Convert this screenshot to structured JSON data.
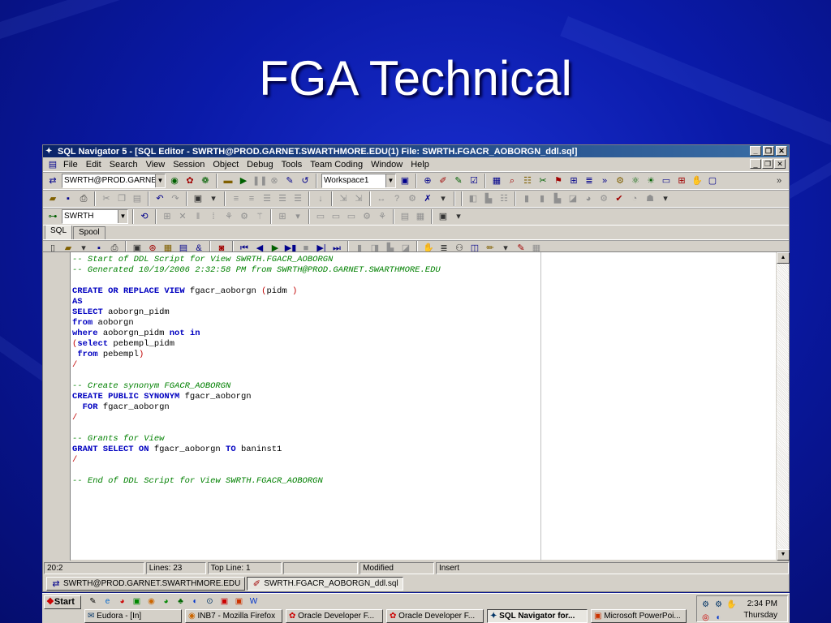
{
  "slide": {
    "title": "FGA Technical"
  },
  "window": {
    "title": "SQL Navigator 5 - [SQL Editor - SWRTH@PROD.GARNET.SWARTHMORE.EDU(1) File: SWRTH.FGACR_AOBORGN_ddl.sql]",
    "menu": [
      "File",
      "Edit",
      "Search",
      "View",
      "Session",
      "Object",
      "Debug",
      "Tools",
      "Team Coding",
      "Window",
      "Help"
    ],
    "connection_combo": "SWRTH@PROD.GARNET",
    "workspace_combo": "Workspace1",
    "schema_combo": "SWRTH",
    "tabs": [
      "SQL",
      "Spool"
    ]
  },
  "editor": {
    "lines": [
      [
        {
          "t": "cm",
          "v": "-- Start of DDL Script for View SWRTH.FGACR_AOBORGN"
        }
      ],
      [
        {
          "t": "cm",
          "v": "-- Generated 10/19/2006 2:32:58 PM from SWRTH@PROD.GARNET.SWARTHMORE.EDU"
        }
      ],
      [],
      [
        {
          "t": "kw",
          "v": "CREATE OR REPLACE VIEW"
        },
        {
          "t": "tx",
          "v": " fgacr_aoborgn "
        },
        {
          "t": "pn",
          "v": "("
        },
        {
          "t": "tx",
          "v": "pidm "
        },
        {
          "t": "pn",
          "v": ")"
        }
      ],
      [
        {
          "t": "kw",
          "v": "AS"
        }
      ],
      [
        {
          "t": "kw",
          "v": "SELECT"
        },
        {
          "t": "tx",
          "v": " aoborgn_pidm"
        }
      ],
      [
        {
          "t": "kw",
          "v": "from"
        },
        {
          "t": "tx",
          "v": " aoborgn"
        }
      ],
      [
        {
          "t": "kw",
          "v": "where"
        },
        {
          "t": "tx",
          "v": " aoborgn_pidm "
        },
        {
          "t": "kw",
          "v": "not in"
        }
      ],
      [
        {
          "t": "pn",
          "v": "("
        },
        {
          "t": "kw",
          "v": "select"
        },
        {
          "t": "tx",
          "v": " pebempl_pidm"
        }
      ],
      [
        {
          "t": "tx",
          "v": " "
        },
        {
          "t": "kw",
          "v": "from"
        },
        {
          "t": "tx",
          "v": " pebempl"
        },
        {
          "t": "pn",
          "v": ")"
        }
      ],
      [
        {
          "t": "pn",
          "v": "/"
        }
      ],
      [],
      [
        {
          "t": "cm",
          "v": "-- Create synonym FGACR_AOBORGN"
        }
      ],
      [
        {
          "t": "kw",
          "v": "CREATE PUBLIC SYNONYM"
        },
        {
          "t": "tx",
          "v": " fgacr_aoborgn"
        }
      ],
      [
        {
          "t": "tx",
          "v": "  "
        },
        {
          "t": "kw",
          "v": "FOR"
        },
        {
          "t": "tx",
          "v": " fgacr_aoborgn"
        }
      ],
      [
        {
          "t": "pn",
          "v": "/"
        }
      ],
      [],
      [
        {
          "t": "cm",
          "v": "-- Grants for View"
        }
      ],
      [
        {
          "t": "kw",
          "v": "GRANT SELECT ON"
        },
        {
          "t": "tx",
          "v": " fgacr_aoborgn "
        },
        {
          "t": "kw",
          "v": "TO"
        },
        {
          "t": "tx",
          "v": " baninst1"
        }
      ],
      [
        {
          "t": "pn",
          "v": "/"
        }
      ],
      [],
      [
        {
          "t": "cm",
          "v": "-- End of DDL Script for View SWRTH.FGACR_AOBORGN"
        }
      ]
    ]
  },
  "status": {
    "position": "20:2",
    "lines": "Lines: 23",
    "top_line": "Top Line: 1",
    "empty": "",
    "modified": "Modified",
    "mode": "Insert"
  },
  "doc_tabs": [
    "SWRTH@PROD.GARNET.SWARTHMORE.EDU",
    "SWRTH.FGACR_AOBORGN_ddl.sql"
  ],
  "taskbar": {
    "start": "Start",
    "buttons": [
      "Eudora - [In]",
      "INB7 - Mozilla Firefox",
      "Oracle Developer F...",
      "Oracle Developer F...",
      "SQL Navigator for...",
      "Microsoft PowerPoi..."
    ],
    "time": "2:34 PM",
    "day": "Thursday"
  }
}
